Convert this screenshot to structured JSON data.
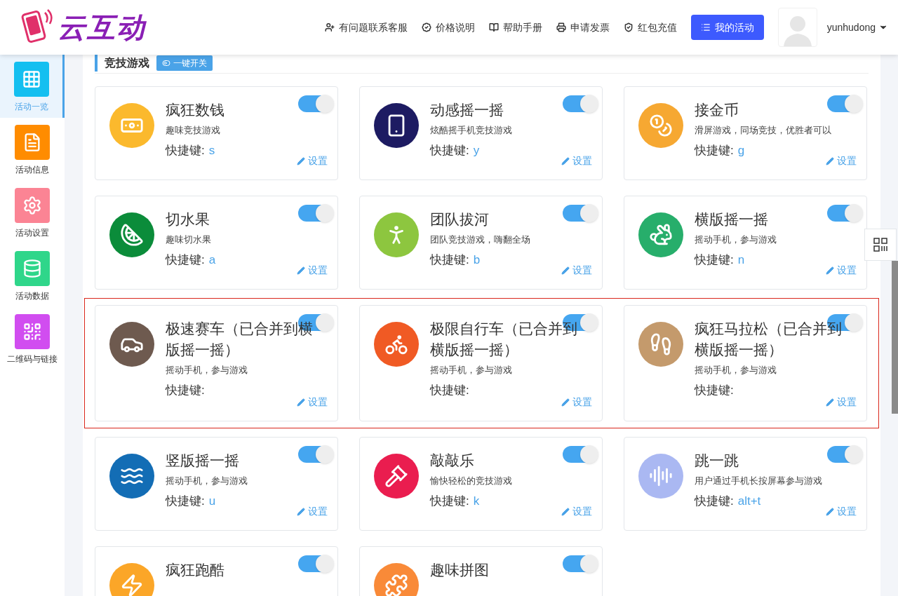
{
  "brand": {
    "name": "云互动"
  },
  "header": {
    "links": [
      {
        "label": "有问题联系客服"
      },
      {
        "label": "价格说明"
      },
      {
        "label": "帮助手册"
      },
      {
        "label": "申请发票"
      },
      {
        "label": "红包充值"
      }
    ],
    "primary_button": "我的活动",
    "username": "yunhudong"
  },
  "sidebar": {
    "items": [
      {
        "label": "活动一览",
        "selected": true,
        "color": "#14bff0"
      },
      {
        "label": "活动信息",
        "selected": false,
        "color": "#ff8c00"
      },
      {
        "label": "活动设置",
        "selected": false,
        "color": "#fb8494"
      },
      {
        "label": "活动数据",
        "selected": false,
        "color": "#2fd68a"
      },
      {
        "label": "二维码与链接",
        "selected": false,
        "color": "#d14df0"
      }
    ]
  },
  "section": {
    "title": "竞技游戏",
    "toggle_all_button": "一键开关"
  },
  "rows": [
    {
      "highlighted": false,
      "games": [
        {
          "name": "疯狂数钱",
          "desc": "趣味竞技游戏",
          "hotkey_label": "快捷键:",
          "hotkey": "s",
          "on": true,
          "settings": "设置",
          "color": "#fbb92d"
        },
        {
          "name": "动感摇一摇",
          "desc": "炫酷摇手机竞技游戏",
          "hotkey_label": "快捷键:",
          "hotkey": "y",
          "on": true,
          "settings": "设置",
          "color": "#1d1b62"
        },
        {
          "name": "接金币",
          "desc": "滑屏游戏，同场竞技，优胜者可以",
          "hotkey_label": "快捷键:",
          "hotkey": "g",
          "on": true,
          "settings": "设置",
          "color": "#f6a832"
        }
      ]
    },
    {
      "highlighted": false,
      "games": [
        {
          "name": "切水果",
          "desc": "趣味切水果",
          "hotkey_label": "快捷键:",
          "hotkey": "a",
          "on": true,
          "settings": "设置",
          "color": "#0b8c3a"
        },
        {
          "name": "团队拔河",
          "desc": "团队竞技游戏，嗨翻全场",
          "hotkey_label": "快捷键:",
          "hotkey": "b",
          "on": true,
          "settings": "设置",
          "color": "#8dc63f"
        },
        {
          "name": "横版摇一摇",
          "desc": "摇动手机，参与游戏",
          "hotkey_label": "快捷键:",
          "hotkey": "n",
          "on": true,
          "settings": "设置",
          "color": "#27ae6b"
        }
      ]
    },
    {
      "highlighted": true,
      "games": [
        {
          "name": "极速赛车（已合并到横版摇一摇）",
          "desc": "摇动手机，参与游戏",
          "hotkey_label": "快捷键:",
          "on": true,
          "settings": "设置",
          "color": "#6e5a4f"
        },
        {
          "name": "极限自行车（已合并到横版摇一摇）",
          "desc": "摇动手机，参与游戏",
          "hotkey_label": "快捷键:",
          "on": true,
          "settings": "设置",
          "color": "#f05a24"
        },
        {
          "name": "疯狂马拉松（已合并到横版摇一摇）",
          "desc": "摇动手机，参与游戏",
          "hotkey_label": "快捷键:",
          "on": true,
          "settings": "设置",
          "color": "#c49a6c"
        }
      ]
    },
    {
      "highlighted": false,
      "games": [
        {
          "name": "竖版摇一摇",
          "desc": "摇动手机，参与游戏",
          "hotkey_label": "快捷键:",
          "hotkey": "u",
          "on": true,
          "settings": "设置",
          "color": "#136db5"
        },
        {
          "name": "敲敲乐",
          "desc": "愉快轻松的竞技游戏",
          "hotkey_label": "快捷键:",
          "hotkey": "k",
          "on": true,
          "settings": "设置",
          "color": "#ea1d4f"
        },
        {
          "name": "跳一跳",
          "desc": "用户通过手机长按屏幕参与游戏",
          "hotkey_label": "快捷键:",
          "hotkey": "alt+t",
          "on": true,
          "settings": "设置",
          "color": "#aab8f2"
        }
      ]
    },
    {
      "highlighted": false,
      "games": [
        {
          "name": "疯狂跑酷",
          "on": true,
          "color": "#fba628"
        },
        {
          "name": "趣味拼图",
          "on": true,
          "color": "#f98a38"
        }
      ]
    }
  ]
}
